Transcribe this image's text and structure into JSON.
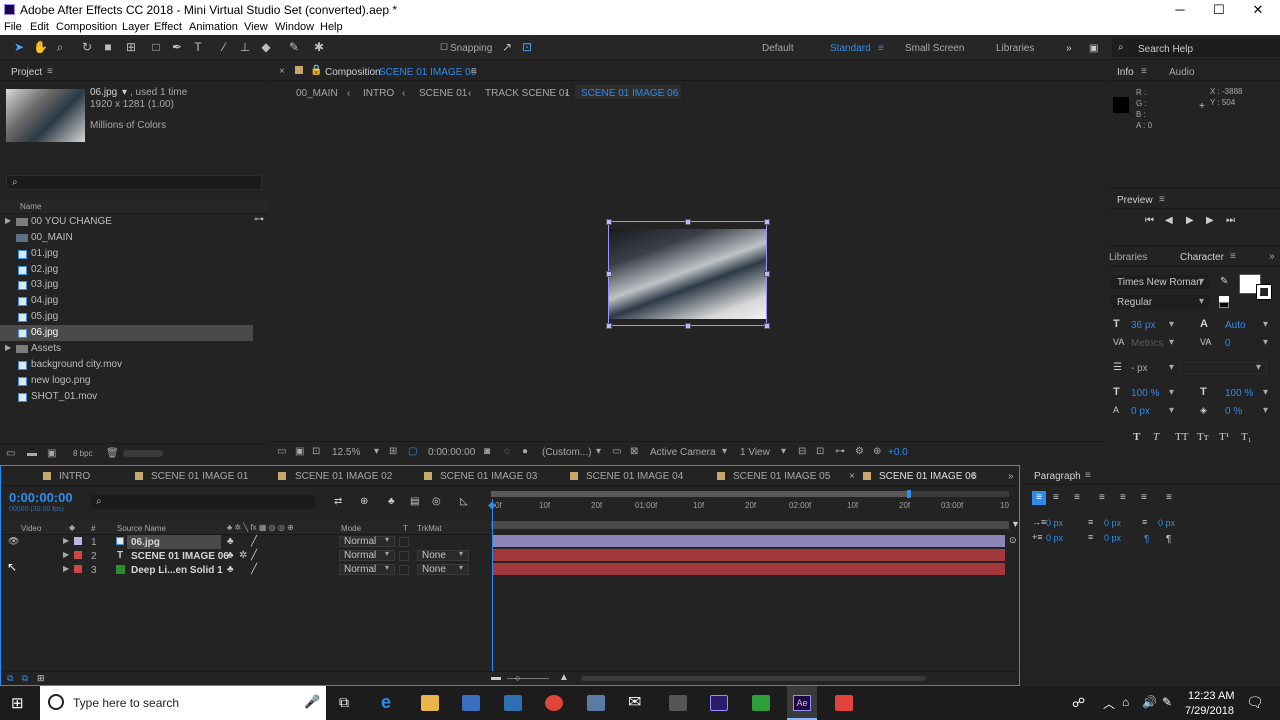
{
  "title": "Adobe After Effects CC 2018 - Mini Virtual Studio Set (converted).aep *",
  "window_controls": {
    "minimize": "─",
    "maximize": "☐",
    "close": "✕"
  },
  "menu": [
    "File",
    "Edit",
    "Composition",
    "Layer",
    "Effect",
    "Animation",
    "View",
    "Window",
    "Help"
  ],
  "toolbar": {
    "snapping": "Snapping",
    "workspaces": [
      "Default",
      "Standard",
      "Small Screen",
      "Libraries"
    ],
    "active_workspace": "Standard",
    "search_help": "Search Help"
  },
  "project": {
    "tab": "Project",
    "selected_name": "06.jpg",
    "used": ", used 1 time",
    "dimensions": "1920 x 1281 (1.00)",
    "colors": "Millions of Colors",
    "column_name": "Name",
    "items": [
      {
        "name": "00 YOU CHANGE",
        "type": "folder"
      },
      {
        "name": "00_MAIN",
        "type": "comp"
      },
      {
        "name": "01.jpg",
        "type": "file"
      },
      {
        "name": "02.jpg",
        "type": "file"
      },
      {
        "name": "03.jpg",
        "type": "file"
      },
      {
        "name": "04.jpg",
        "type": "file"
      },
      {
        "name": "05.jpg",
        "type": "file"
      },
      {
        "name": "06.jpg",
        "type": "file"
      },
      {
        "name": "Assets",
        "type": "folder"
      },
      {
        "name": "background city.mov",
        "type": "file"
      },
      {
        "name": "new logo.png",
        "type": "file"
      },
      {
        "name": "SHOT_01.mov",
        "type": "file"
      }
    ],
    "bpc": "8 bpc"
  },
  "composition": {
    "tab_prefix": "Composition",
    "tab_name": "SCENE 01 IMAGE 06",
    "breadcrumbs": [
      "00_MAIN",
      "INTRO",
      "SCENE 01",
      "TRACK SCENE 01",
      "SCENE 01 IMAGE 06"
    ],
    "zoom": "12.5%",
    "time": "0:00:00:00",
    "resolution": "(Custom...)",
    "camera": "Active Camera",
    "view": "1 View",
    "exposure": "+0.0"
  },
  "info": {
    "tab": "Info",
    "audio_tab": "Audio",
    "r": "R :",
    "g": "G :",
    "b": "B :",
    "a": "A : 0",
    "x": "X : -3888",
    "y": "Y : 504"
  },
  "preview": {
    "tab": "Preview"
  },
  "character": {
    "libraries_tab": "Libraries",
    "tab": "Character",
    "font": "Times New Roman",
    "style": "Regular",
    "size": "36 px",
    "leading": "Auto",
    "kerning": "Metrics",
    "tracking": "0",
    "stroke": "- px",
    "vscale": "100 %",
    "hscale": "100 %",
    "baseline": "0 px",
    "tsume": "0 %"
  },
  "paragraph": {
    "tab": "Paragraph",
    "indent_left": "0 px",
    "indent_first": "0 px",
    "indent_right": "0 px",
    "space_before": "0 px",
    "space_after": "0 px"
  },
  "timeline": {
    "tabs": [
      "INTRO",
      "SCENE 01 IMAGE 01",
      "SCENE 01 IMAGE 02",
      "SCENE 01 IMAGE 03",
      "SCENE 01 IMAGE 04",
      "SCENE 01 IMAGE 05",
      "SCENE 01 IMAGE 06"
    ],
    "timecode": "0:00:00:00",
    "frames": "00000 (30.00 fps)",
    "cols": {
      "video": "Video",
      "num": "#",
      "source": "Source Name",
      "mode": "Mode",
      "t": "T",
      "trkmat": "TrkMat"
    },
    "layers": [
      {
        "num": "1",
        "name": "06.jpg",
        "mode": "Normal",
        "trkmat": "",
        "color": "#b8b8e8"
      },
      {
        "num": "2",
        "name": "SCENE 01 IMAGE 06",
        "mode": "Normal",
        "trkmat": "None",
        "color": "#c84848"
      },
      {
        "num": "3",
        "name": "Deep Li...en Solid 1",
        "mode": "Normal",
        "trkmat": "None",
        "color": "#c84848"
      }
    ],
    "ruler": [
      "0f",
      "10f",
      "20f",
      "01:00f",
      "10f",
      "20f",
      "02:00f",
      "10f",
      "20f",
      "03:00f",
      "10"
    ]
  },
  "taskbar": {
    "search": "Type here to search",
    "time": "12:23 AM",
    "date": "7/29/2018"
  }
}
